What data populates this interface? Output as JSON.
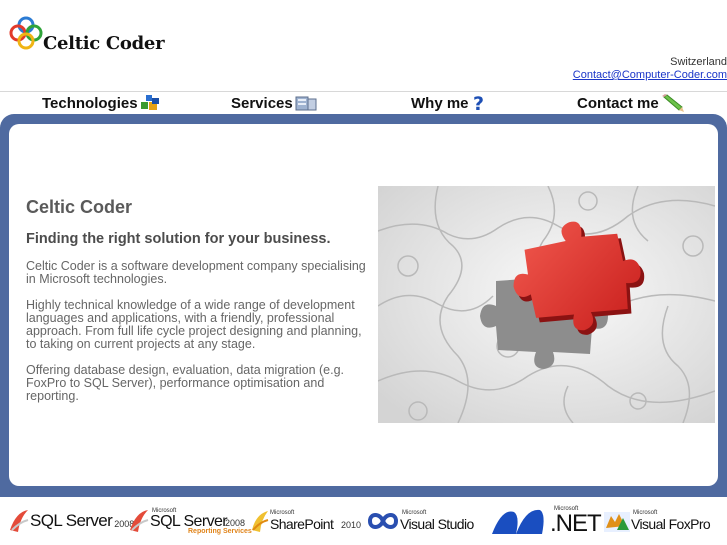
{
  "header": {
    "brand_name": "Celtic Coder",
    "location": "Switzerland",
    "email": "Contact@Computer-Coder.com"
  },
  "nav": {
    "items": [
      {
        "label": "Technologies",
        "icon": "cubes-icon"
      },
      {
        "label": "Services",
        "icon": "server-icon"
      },
      {
        "label": "Why me",
        "icon": "question-icon"
      },
      {
        "label": "Contact me",
        "icon": "pencil-icon"
      }
    ]
  },
  "main": {
    "title": "Celtic Coder",
    "subtitle": "Finding the right solution for your business.",
    "paragraphs": [
      "Celtic Coder is a software development company specialising in Microsoft technologies.",
      "Highly technical knowledge of a wide range of development languages and applications, with a friendly, professional approach. From full life cycle project designing and planning, to taking on current projects at any stage.",
      "Offering database design, evaluation, data migration (e.g. FoxPro to SQL Server), performance optimisation and reporting."
    ],
    "image": "puzzle-image"
  },
  "footer": {
    "logos": [
      {
        "name": "SQL Server",
        "version": "2008"
      },
      {
        "brand": "Microsoft",
        "name": "SQL Server",
        "version": "2008",
        "sub": "Reporting Services"
      },
      {
        "brand": "Microsoft",
        "name": "SharePoint",
        "version": "2010"
      },
      {
        "brand": "Microsoft",
        "name": "Visual Studio"
      },
      {
        "brand": "Microsoft",
        "name": ".NET"
      },
      {
        "brand": "Microsoft",
        "name": "Visual FoxPro"
      }
    ]
  },
  "colors": {
    "frame": "#4f6aa0",
    "link": "#1a35c8",
    "puzzle_piece": "#e2302e"
  }
}
